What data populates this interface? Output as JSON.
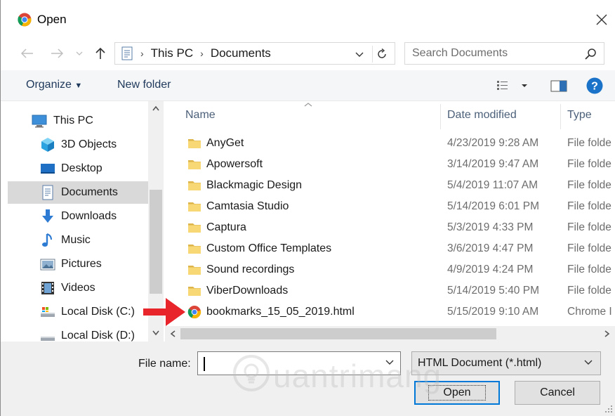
{
  "window": {
    "title": "Open",
    "close_icon": "close-icon"
  },
  "navbar": {
    "breadcrumb": [
      "This PC",
      "Documents"
    ],
    "search_placeholder": "Search Documents"
  },
  "toolbar": {
    "organize_label": "Organize",
    "new_folder_label": "New folder"
  },
  "sidebar": {
    "items": [
      {
        "label": "This PC",
        "icon": "computer-icon"
      },
      {
        "label": "3D Objects",
        "icon": "cube-icon"
      },
      {
        "label": "Desktop",
        "icon": "desktop-icon"
      },
      {
        "label": "Documents",
        "icon": "documents-icon",
        "selected": true
      },
      {
        "label": "Downloads",
        "icon": "download-arrow-icon"
      },
      {
        "label": "Music",
        "icon": "music-note-icon"
      },
      {
        "label": "Pictures",
        "icon": "pictures-icon"
      },
      {
        "label": "Videos",
        "icon": "film-icon"
      },
      {
        "label": "Local Disk (C:)",
        "icon": "disk-icon"
      },
      {
        "label": "Local Disk (D:)",
        "icon": "disk-icon"
      }
    ]
  },
  "filelist": {
    "columns": [
      "Name",
      "Date modified",
      "Type"
    ],
    "rows": [
      {
        "name": "AnyGet",
        "date": "4/23/2019 9:28 AM",
        "type": "File folde",
        "icon": "folder-icon"
      },
      {
        "name": "Apowersoft",
        "date": "3/14/2019 9:47 AM",
        "type": "File folde",
        "icon": "folder-icon"
      },
      {
        "name": "Blackmagic Design",
        "date": "5/4/2019 11:07 AM",
        "type": "File folde",
        "icon": "folder-icon"
      },
      {
        "name": "Camtasia Studio",
        "date": "5/14/2019 6:01 PM",
        "type": "File folde",
        "icon": "folder-icon"
      },
      {
        "name": "Captura",
        "date": "5/3/2019 4:33 PM",
        "type": "File folde",
        "icon": "folder-icon"
      },
      {
        "name": "Custom Office Templates",
        "date": "3/6/2019 4:47 PM",
        "type": "File folde",
        "icon": "folder-icon"
      },
      {
        "name": "Sound recordings",
        "date": "4/9/2019 4:24 PM",
        "type": "File folde",
        "icon": "folder-icon"
      },
      {
        "name": "ViberDownloads",
        "date": "5/14/2019 5:40 PM",
        "type": "File folde",
        "icon": "folder-icon"
      },
      {
        "name": "bookmarks_15_05_2019.html",
        "date": "5/15/2019 9:10 AM",
        "type": "Chrome I",
        "icon": "chrome-icon"
      }
    ]
  },
  "bottom": {
    "file_name_label": "File name:",
    "file_name_value": "",
    "file_type_value": "HTML Document (*.html)",
    "open_label": "Open",
    "cancel_label": "Cancel"
  },
  "watermark": {
    "text": "uantrimang"
  },
  "colors": {
    "accent": "#0078d7",
    "selected_bg": "#d9d9d9",
    "folder": "#f8d775",
    "arrow": "#e8252b",
    "help": "#1a73c8"
  }
}
